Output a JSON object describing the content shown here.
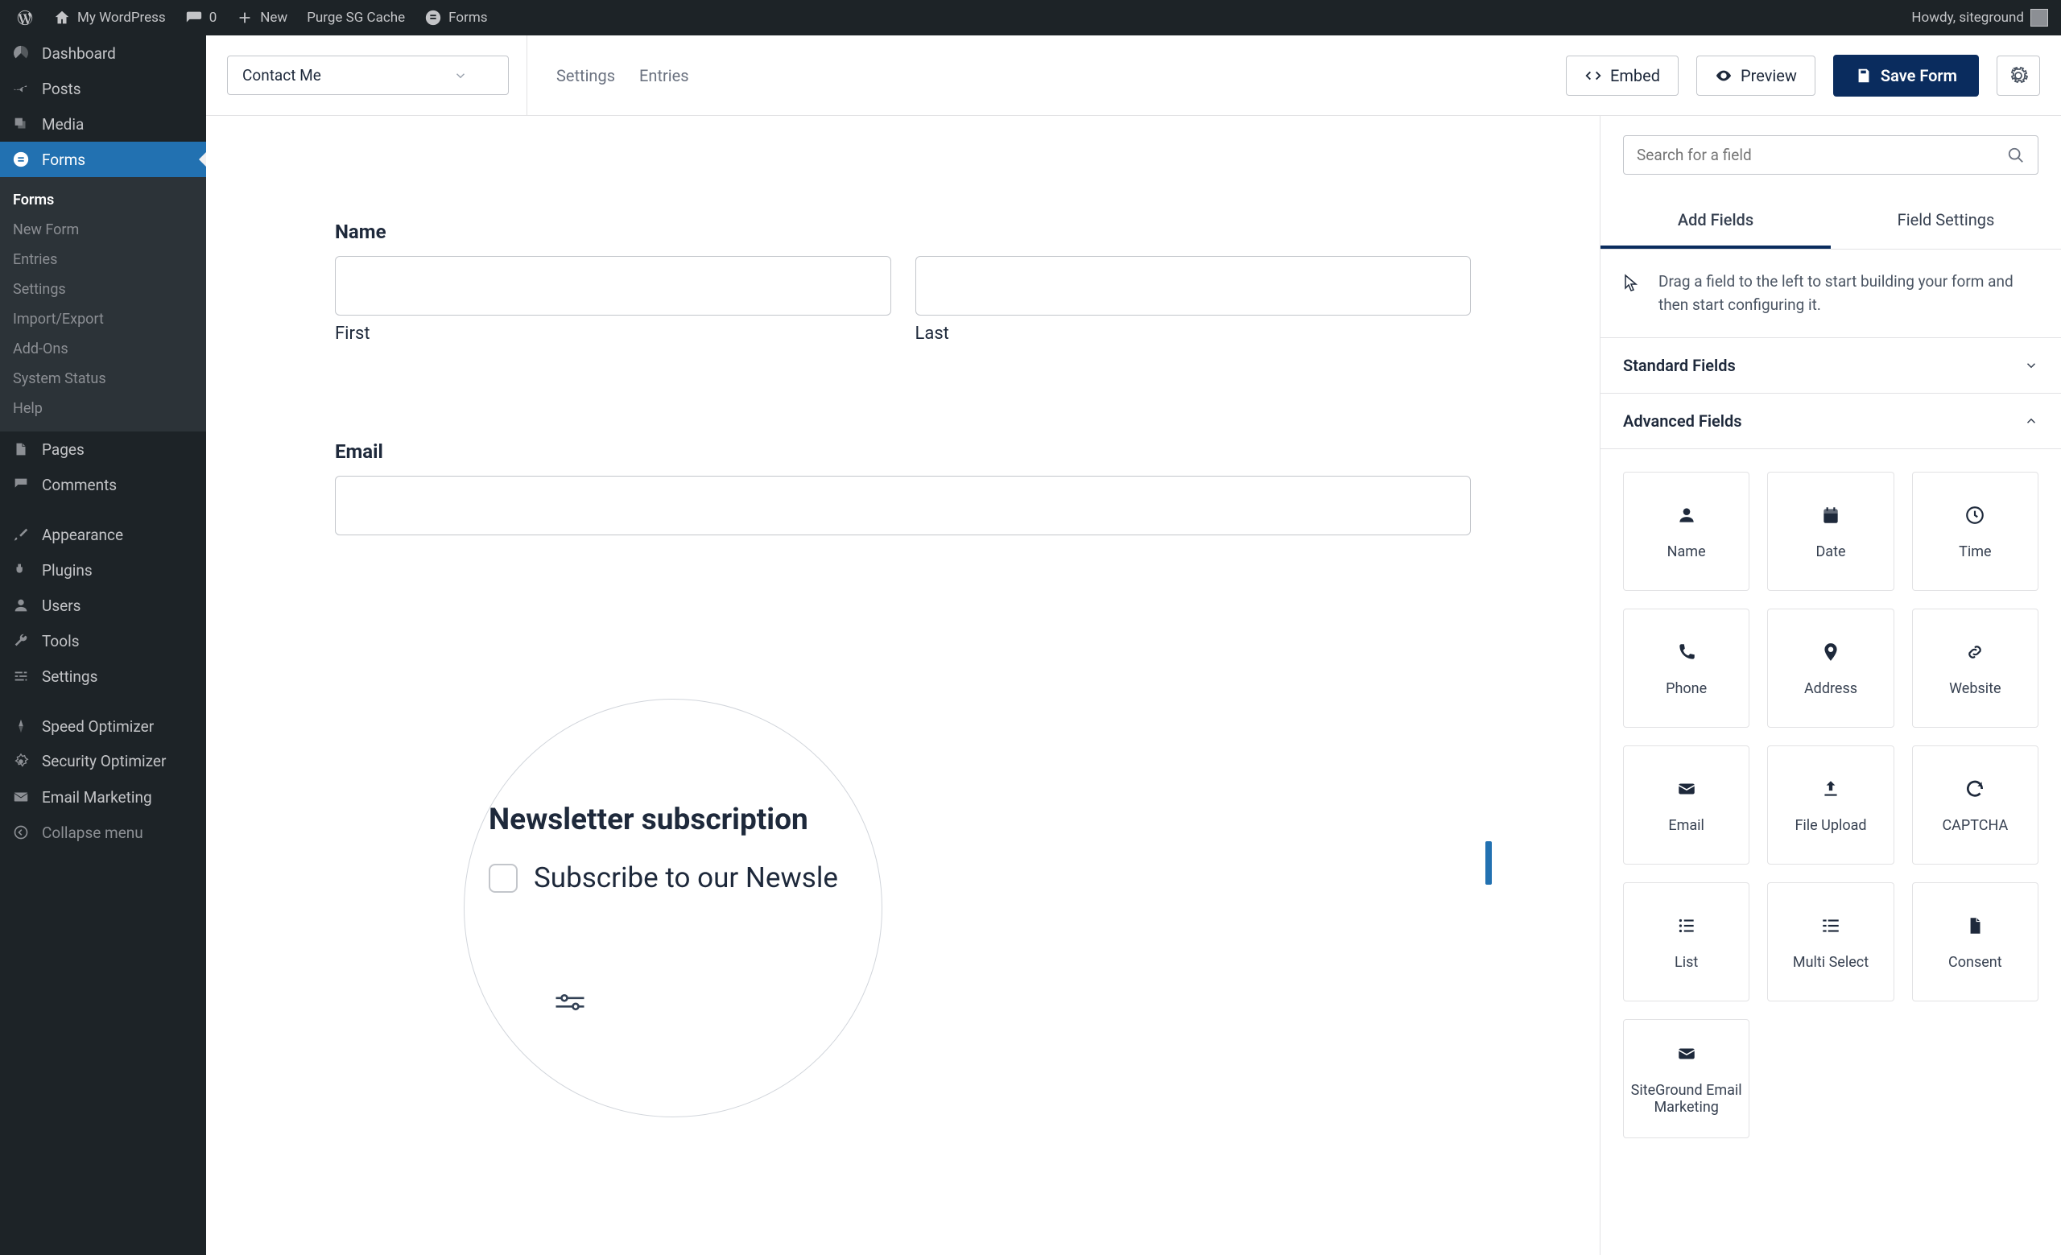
{
  "adminbar": {
    "site": "My WordPress",
    "comments": "0",
    "new": "New",
    "purge": "Purge SG Cache",
    "forms": "Forms",
    "howdy": "Howdy, siteground"
  },
  "sidebar": {
    "dashboard": "Dashboard",
    "posts": "Posts",
    "media": "Media",
    "forms": "Forms",
    "sub": {
      "forms": "Forms",
      "newform": "New Form",
      "entries": "Entries",
      "settings": "Settings",
      "importexport": "Import/Export",
      "addons": "Add-Ons",
      "systemstatus": "System Status",
      "help": "Help"
    },
    "pages": "Pages",
    "comments": "Comments",
    "appearance": "Appearance",
    "plugins": "Plugins",
    "users": "Users",
    "tools": "Tools",
    "settings": "Settings",
    "speed": "Speed Optimizer",
    "security": "Security Optimizer",
    "emailmkt": "Email Marketing",
    "collapse": "Collapse menu"
  },
  "toolbar": {
    "formname": "Contact Me",
    "settings": "Settings",
    "entries": "Entries",
    "embed": "Embed",
    "preview": "Preview",
    "save": "Save Form"
  },
  "form": {
    "name_label": "Name",
    "first": "First",
    "last": "Last",
    "email_label": "Email"
  },
  "magnifier": {
    "title": "Newsletter subscription",
    "option": "Subscribe to our Newsle"
  },
  "rpanel": {
    "search_placeholder": "Search for a field",
    "tab_add": "Add Fields",
    "tab_settings": "Field Settings",
    "hint": "Drag a field to the left to start building your form and then start configuring it.",
    "standard": "Standard Fields",
    "advanced": "Advanced Fields",
    "fields": {
      "name": "Name",
      "date": "Date",
      "time": "Time",
      "phone": "Phone",
      "address": "Address",
      "website": "Website",
      "email": "Email",
      "fileupload": "File Upload",
      "captcha": "CAPTCHA",
      "list": "List",
      "multiselect": "Multi Select",
      "consent": "Consent",
      "sgemail": "SiteGround Email Marketing"
    }
  }
}
